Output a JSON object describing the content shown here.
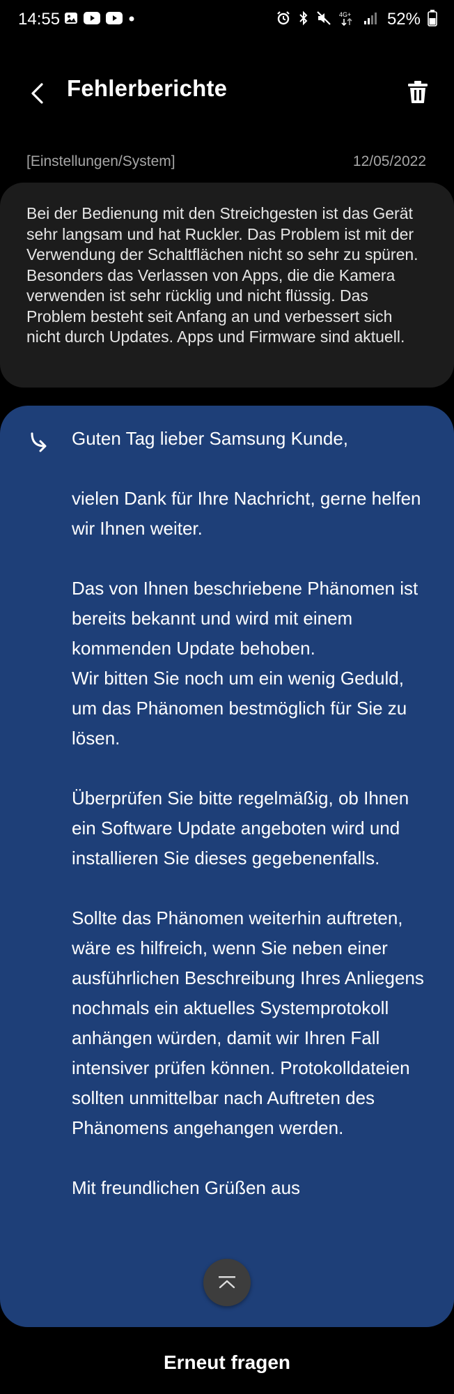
{
  "status_bar": {
    "time": "14:55",
    "network": "4G+",
    "battery": "52%"
  },
  "header": {
    "title": "Fehlerberichte"
  },
  "report": {
    "category": "[Einstellungen/System]",
    "date": "12/05/2022",
    "question": "Bei der Bedienung mit den Streichgesten ist das Gerät sehr langsam und hat Ruckler. Das Problem ist mit der Verwendung der Schaltflächen nicht so sehr zu spüren. Besonders das Verlassen von Apps, die die Kamera verwenden ist sehr rücklig und nicht flüssig. Das Problem besteht seit Anfang an und verbessert sich nicht durch Updates. Apps und Firmware sind aktuell."
  },
  "answer": {
    "paragraphs": [
      "Guten Tag lieber Samsung Kunde,",
      "vielen Dank für Ihre Nachricht, gerne helfen wir Ihnen weiter.",
      "Das von Ihnen beschriebene Phänomen ist bereits bekannt und wird mit einem kommenden Update behoben.\nWir bitten Sie noch um ein wenig Geduld, um das Phänomen bestmöglich für Sie zu lösen.",
      "Überprüfen Sie bitte regelmäßig, ob Ihnen ein Software Update angeboten wird und installieren Sie dieses gegebenenfalls.",
      "Sollte das Phänomen weiterhin auftreten, wäre es hilfreich, wenn Sie neben einer ausführlichen Beschreibung Ihres Anliegens nochmals ein aktuelles Systemprotokoll anhängen würden, damit wir Ihren Fall intensiver prüfen können. Protokolldateien sollten unmittelbar nach Auftreten des Phänomens angehangen werden.",
      "Mit freundlichen Grüßen aus"
    ]
  },
  "actions": {
    "ask_again": "Erneut fragen"
  },
  "icons": {
    "back": "back-arrow-icon",
    "delete": "trash-icon",
    "reply": "reply-arrow-icon",
    "scroll_top": "scroll-to-top-icon"
  },
  "colors": {
    "background": "#000000",
    "question_card": "#1c1c1c",
    "answer_card": "#1e3f78",
    "meta_text": "#a6a6a6"
  }
}
